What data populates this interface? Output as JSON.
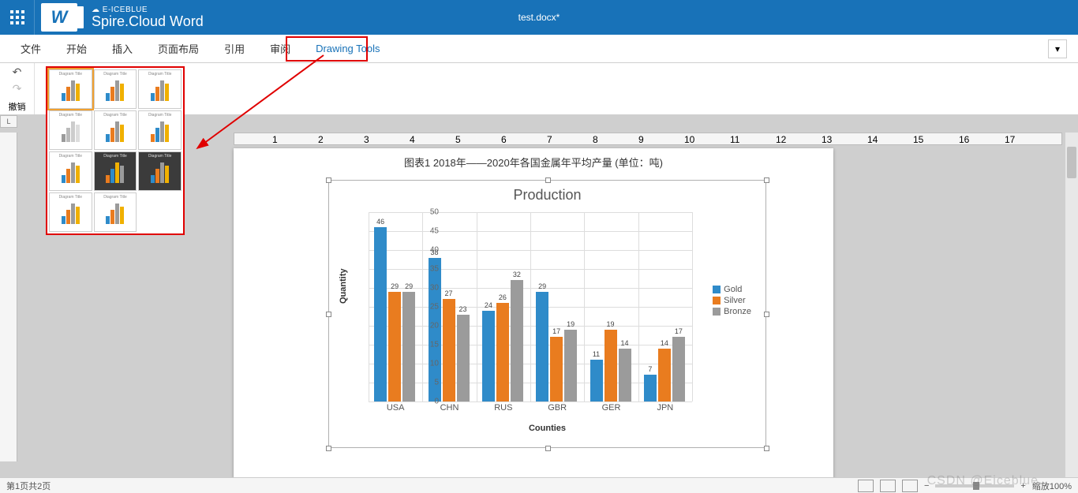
{
  "brand": {
    "small": "☁ E-ICEBLUE",
    "big": "Spire.Cloud Word",
    "w": "W"
  },
  "doc_title": "test.docx*",
  "menu": {
    "file": "文件",
    "home": "开始",
    "insert": "插入",
    "layout": "页面布局",
    "references": "引用",
    "review": "审阅",
    "drawing_tools": "Drawing Tools"
  },
  "undo_label": "撤销",
  "ruler_L": "L",
  "caption": "图表1  2018年——2020年各国金属年平均产量  (单位：吨)",
  "status": {
    "page": "第1页共2页",
    "zoom": "缩放100%"
  },
  "watermark": "CSDN @Eiceblue",
  "thumb_title": "Diagram Title",
  "colors": {
    "gold": "#2f8bc9",
    "silver": "#e97c1f",
    "bronze": "#9b9b9b",
    "brand": "#1872b8",
    "annot": "#e00000"
  },
  "chart_data": {
    "type": "bar",
    "title": "Production",
    "xlabel": "Counties",
    "ylabel": "Quantity",
    "ylim": [
      0,
      50
    ],
    "yticks": [
      0,
      5,
      10,
      15,
      20,
      25,
      30,
      35,
      40,
      45,
      50
    ],
    "categories": [
      "USA",
      "CHN",
      "RUS",
      "GBR",
      "GER",
      "JPN"
    ],
    "series": [
      {
        "name": "Gold",
        "values": [
          46,
          38,
          24,
          29,
          11,
          7
        ]
      },
      {
        "name": "Silver",
        "values": [
          29,
          27,
          26,
          17,
          19,
          14
        ]
      },
      {
        "name": "Bronze",
        "values": [
          29,
          23,
          32,
          19,
          14,
          17
        ]
      }
    ]
  }
}
